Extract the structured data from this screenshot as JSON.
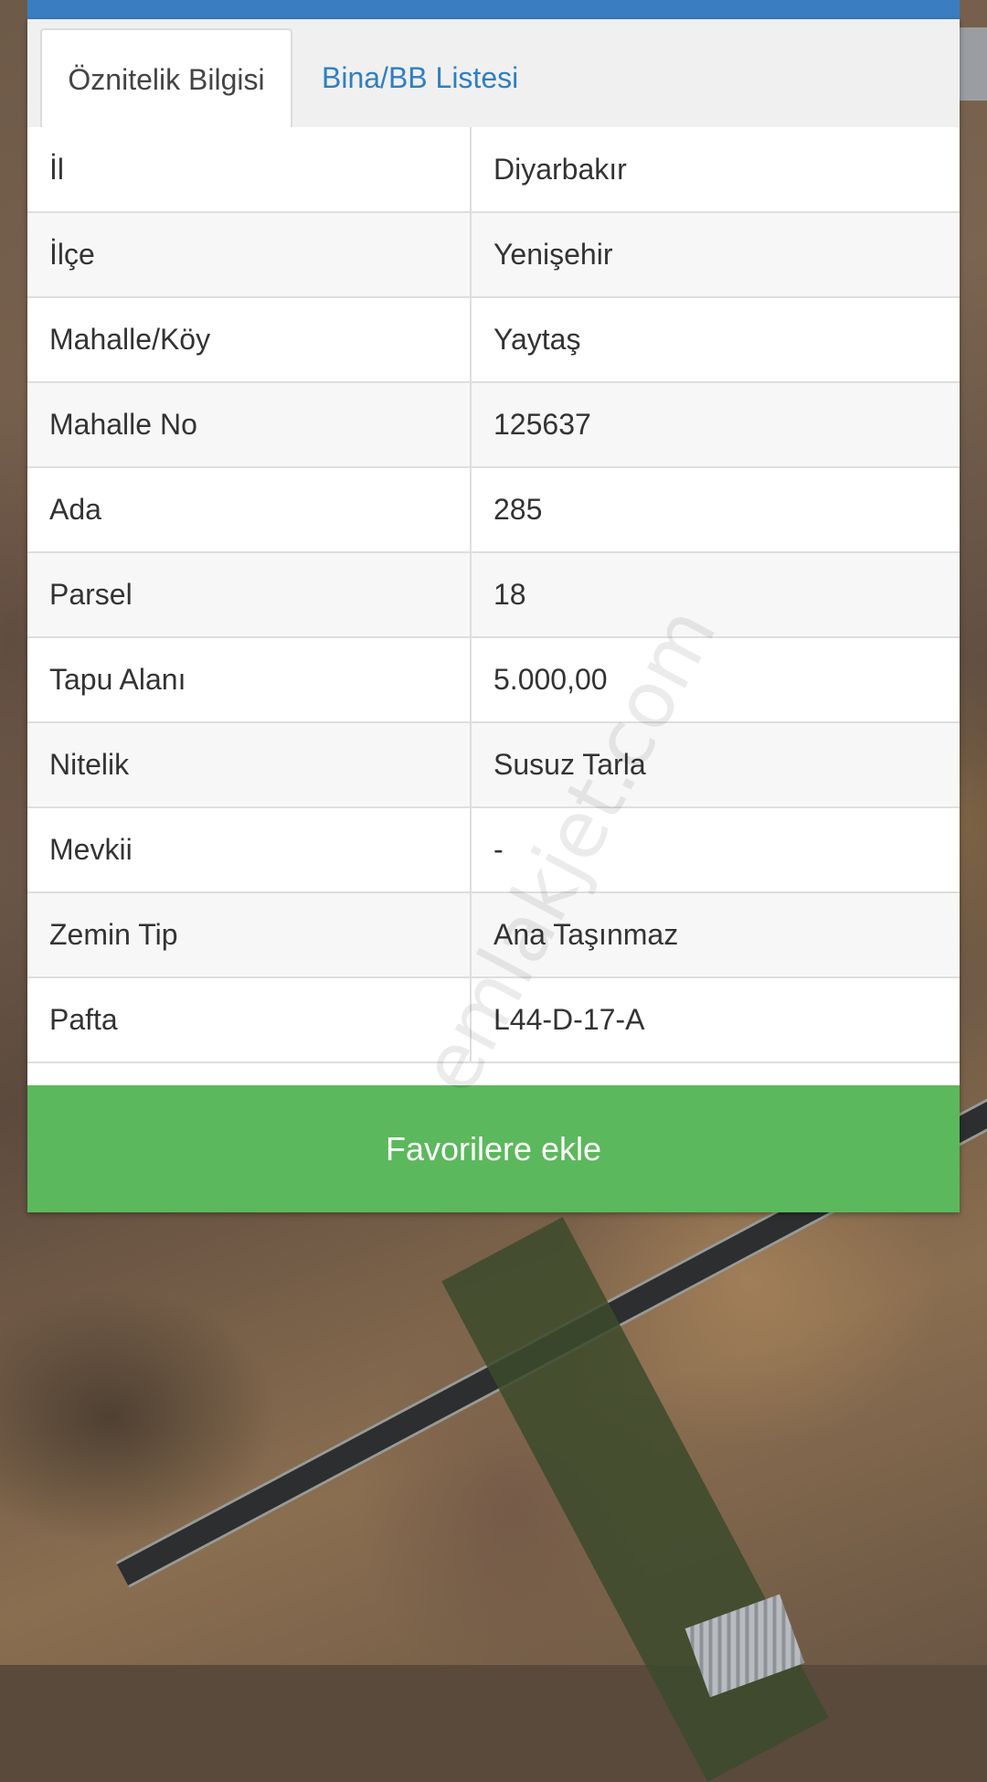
{
  "tabs": [
    {
      "label": "Öznitelik Bilgisi",
      "active": true
    },
    {
      "label": "Bina/BB Listesi",
      "active": false
    }
  ],
  "attributes": [
    {
      "key": "İl",
      "value": "Diyarbakır"
    },
    {
      "key": "İlçe",
      "value": "Yenişehir"
    },
    {
      "key": "Mahalle/Köy",
      "value": "Yaytaş"
    },
    {
      "key": "Mahalle No",
      "value": "125637"
    },
    {
      "key": "Ada",
      "value": "285"
    },
    {
      "key": "Parsel",
      "value": "18"
    },
    {
      "key": "Tapu Alanı",
      "value": "5.000,00"
    },
    {
      "key": "Nitelik",
      "value": "Susuz Tarla"
    },
    {
      "key": "Mevkii",
      "value": "-"
    },
    {
      "key": "Zemin Tip",
      "value": "Ana Taşınmaz"
    },
    {
      "key": "Pafta",
      "value": "L44-D-17-A"
    }
  ],
  "actions": {
    "favorite_label": "Favorilere ekle"
  },
  "watermark": "emlakjet.com",
  "colors": {
    "header": "#3a7ec1",
    "tab_link": "#2f7fc1",
    "button": "#5cb85c"
  }
}
